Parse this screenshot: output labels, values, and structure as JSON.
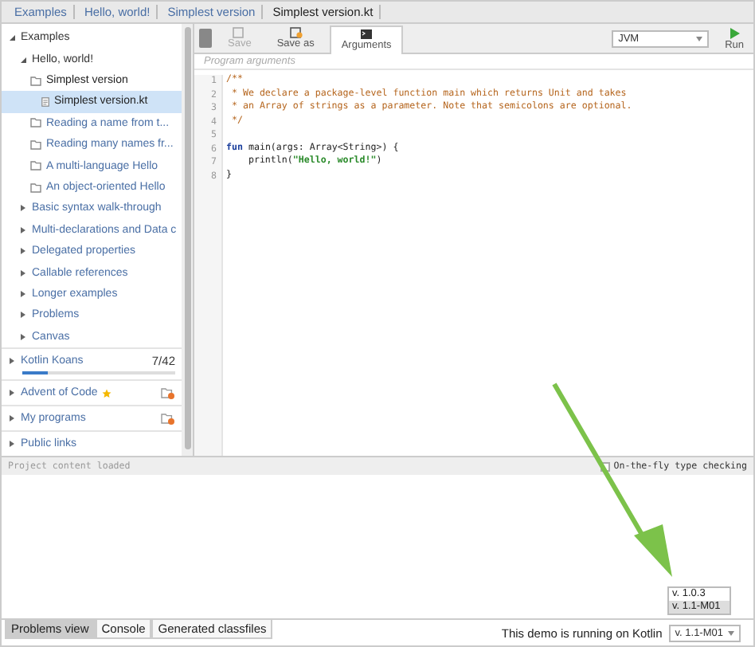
{
  "breadcrumbs": [
    {
      "label": "Examples",
      "selected": false
    },
    {
      "label": "Hello, world!",
      "selected": false
    },
    {
      "label": "Simplest version",
      "selected": false
    },
    {
      "label": "Simplest version.kt",
      "selected": true
    }
  ],
  "tree": [
    {
      "label": "Examples",
      "kind": "section",
      "expanded": true,
      "children": [
        {
          "label": "Hello, world!",
          "kind": "section",
          "expanded": true,
          "children": [
            {
              "label": "Simplest version",
              "kind": "folder",
              "expanded": true,
              "selected": false,
              "children": [
                {
                  "label": "Simplest version.kt",
                  "kind": "file",
                  "selected": true
                }
              ]
            },
            {
              "label": "Reading a name from t...",
              "kind": "folder",
              "selected": false
            },
            {
              "label": "Reading many names fr...",
              "kind": "folder",
              "selected": false
            },
            {
              "label": "A multi-language Hello",
              "kind": "folder",
              "selected": false
            },
            {
              "label": "An object-oriented Hello",
              "kind": "folder",
              "selected": false
            }
          ]
        },
        {
          "label": "Basic syntax walk-through",
          "kind": "link",
          "expanded": false
        },
        {
          "label": "Multi-declarations and Data c",
          "kind": "link",
          "expanded": false
        },
        {
          "label": "Delegated properties",
          "kind": "link",
          "expanded": false
        },
        {
          "label": "Callable references",
          "kind": "link",
          "expanded": false
        },
        {
          "label": "Longer examples",
          "kind": "link",
          "expanded": false
        },
        {
          "label": "Problems",
          "kind": "link",
          "expanded": false
        },
        {
          "label": "Canvas",
          "kind": "link",
          "expanded": false
        }
      ]
    }
  ],
  "sections": [
    {
      "label": "Kotlin Koans",
      "count": "7/42",
      "level": 0.17
    },
    {
      "label": "Advent of Code",
      "starred": true,
      "add_folder": true
    },
    {
      "label": "My programs",
      "add_folder": true
    },
    {
      "label": "Public links"
    }
  ],
  "toolbar": {
    "buttons": [
      {
        "label": "Save",
        "kind": "save",
        "disabled": true
      },
      {
        "label": "Save as",
        "kind": "saveas",
        "disabled": false
      },
      {
        "label": "Arguments",
        "kind": "args",
        "disabled": false
      }
    ],
    "target": "JVM",
    "run": "Run"
  },
  "arguments": {
    "placeholder": "Program arguments"
  },
  "code": [
    {
      "number": "1",
      "segments": [
        {
          "kind": "comment",
          "text": "/**"
        }
      ]
    },
    {
      "number": "2",
      "segments": [
        {
          "kind": "comment",
          "text": " * We declare a package-level function main which returns Unit and takes"
        }
      ]
    },
    {
      "number": "3",
      "segments": [
        {
          "kind": "comment",
          "text": " * an Array of strings as a parameter. Note that semicolons are optional."
        }
      ]
    },
    {
      "number": "4",
      "segments": [
        {
          "kind": "comment",
          "text": " */"
        }
      ]
    },
    {
      "number": "5"
    },
    {
      "number": "6",
      "segments": [
        {
          "kind": "keyword",
          "text": "fun"
        },
        {
          "kind": "plain",
          "text": " main(args: Array<String>) {"
        }
      ]
    },
    {
      "number": "7",
      "segments": [
        {
          "kind": "plain",
          "text": "    println("
        },
        {
          "kind": "string",
          "text": "\"Hello, world!\""
        },
        {
          "kind": "plain",
          "text": ")"
        }
      ]
    },
    {
      "number": "8",
      "segments": [
        {
          "kind": "plain",
          "text": "}"
        }
      ]
    }
  ],
  "status": {
    "message": "Project content loaded",
    "type_checking": {
      "label": "On-the-fly type checking",
      "checked": false
    }
  },
  "bottom_tabs": [
    {
      "label": "Problems view",
      "selected": true
    },
    {
      "label": "Console",
      "selected": false
    },
    {
      "label": "Generated classfiles",
      "selected": false
    }
  ],
  "footer": {
    "text": "This demo is running on Kotlin",
    "version": "v. 1.1-M01",
    "options": [
      {
        "label": "v. 1.0.3",
        "selected": false
      },
      {
        "label": "v. 1.1-M01",
        "selected": true
      }
    ]
  }
}
